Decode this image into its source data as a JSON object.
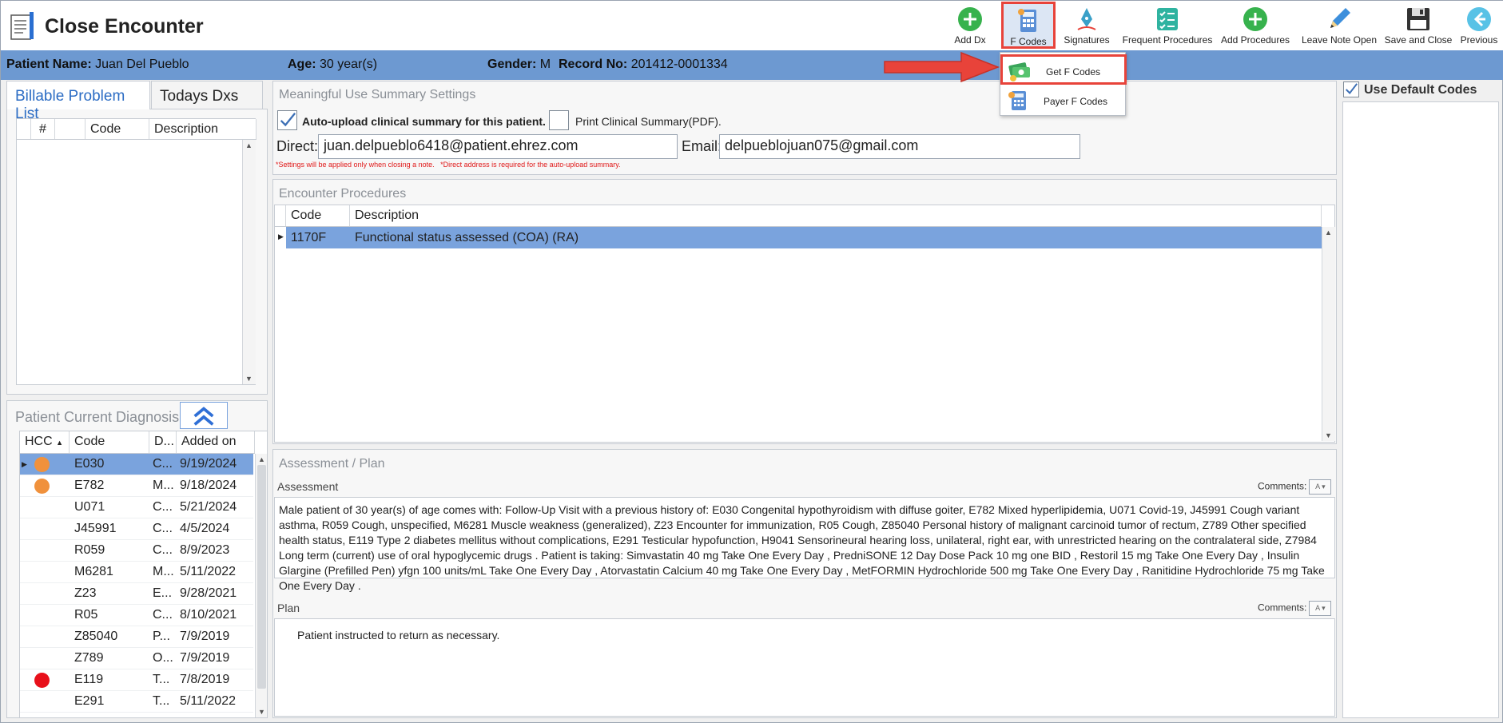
{
  "window": {
    "title": "Close Encounter"
  },
  "toolbar": {
    "add_dx": "Add Dx",
    "f_codes": "F Codes",
    "signatures": "Signatures",
    "frequent_procedures": "Frequent Procedures",
    "add_procedures": "Add Procedures",
    "leave_note_open": "Leave Note Open",
    "save_and_close": "Save and Close",
    "previous": "Previous"
  },
  "fcodes_menu": {
    "get_f_codes": "Get F Codes",
    "payer_f_codes": "Payer F Codes"
  },
  "patient": {
    "name_label": "Patient Name:",
    "name": "Juan Del Pueblo",
    "age_label": "Age:",
    "age": "30 year(s)",
    "gender_label": "Gender:",
    "gender": "M",
    "record_label": "Record No:",
    "record": "201412-0001334"
  },
  "left_tabs": {
    "billable": "Billable Problem List",
    "todays": "Todays Dxs"
  },
  "billable_grid": {
    "col_num": "#",
    "col_code": "Code",
    "col_desc": "Description"
  },
  "current_dx": {
    "title": "Patient Current Diagnosis",
    "headers": {
      "hcc": "HCC",
      "code": "Code",
      "desc": "D...",
      "added": "Added on"
    },
    "rows": [
      {
        "hcc": "orange",
        "code": "E030",
        "desc": "C...",
        "added": "9/19/2024"
      },
      {
        "hcc": "orange",
        "code": "E782",
        "desc": "M...",
        "added": "9/18/2024"
      },
      {
        "hcc": "",
        "code": "U071",
        "desc": "C...",
        "added": "5/21/2024"
      },
      {
        "hcc": "",
        "code": "J45991",
        "desc": "C...",
        "added": "4/5/2024"
      },
      {
        "hcc": "",
        "code": "R059",
        "desc": "C...",
        "added": "8/9/2023"
      },
      {
        "hcc": "",
        "code": "M6281",
        "desc": "M...",
        "added": "5/11/2022"
      },
      {
        "hcc": "",
        "code": "Z23",
        "desc": "E...",
        "added": "9/28/2021"
      },
      {
        "hcc": "",
        "code": "R05",
        "desc": "C...",
        "added": "8/10/2021"
      },
      {
        "hcc": "",
        "code": "Z85040",
        "desc": "P...",
        "added": "7/9/2019"
      },
      {
        "hcc": "",
        "code": "Z789",
        "desc": "O...",
        "added": "7/9/2019"
      },
      {
        "hcc": "red",
        "code": "E119",
        "desc": "T...",
        "added": "7/8/2019"
      },
      {
        "hcc": "",
        "code": "E291",
        "desc": "T...",
        "added": "5/11/2022"
      }
    ]
  },
  "mu": {
    "title": "Meaningful Use Summary Settings",
    "auto_upload": "Auto-upload clinical summary for this patient.",
    "print_summary": "Print Clinical Summary(PDF).",
    "direct_label": "Direct:",
    "direct_value": "juan.delpueblo6418@patient.ehrez.com",
    "email_label": "Email:",
    "email_value": "delpueblojuan075@gmail.com",
    "note": "*Settings will be applied only when closing a note.   *Direct address is required for the auto-upload summary."
  },
  "procedures": {
    "title": "Encounter Procedures",
    "col_code": "Code",
    "col_desc": "Description",
    "rows": [
      {
        "code": "1170F",
        "desc": "Functional status assessed (COA) (RA)"
      }
    ]
  },
  "ap": {
    "title": "Assessment / Plan",
    "assessment_label": "Assessment",
    "comments_label": "Comments:",
    "assessment_text": "Male patient of 30 year(s) of age comes with: Follow-Up Visit  with a previous history of: E030 Congenital hypothyroidism with diffuse goiter, E782 Mixed hyperlipidemia, U071 Covid-19, J45991 Cough variant asthma, R059 Cough, unspecified, M6281 Muscle weakness (generalized), Z23 Encounter for immunization, R05 Cough, Z85040 Personal history of malignant carcinoid tumor of rectum, Z789 Other specified health status, E119 Type 2 diabetes mellitus without complications, E291 Testicular hypofunction, H9041 Sensorineural hearing loss, unilateral, right ear, with unrestricted hearing on the contralateral side, Z7984 Long term (current) use of oral hypoglycemic drugs .  Patient is taking: Simvastatin 40 mg Take One Every Day , PredniSONE 12 Day Dose Pack 10 mg one BID , Restoril 15 mg Take One Every Day , Insulin Glargine (Prefilled Pen) yfgn 100 units/mL Take One Every Day , Atorvastatin Calcium 40 mg Take One Every Day , MetFORMIN Hydrochloride 500 mg Take One Every Day , Ranitidine Hydrochloride 75 mg Take One Every Day  .",
    "plan_label": "Plan",
    "plan_text": "Patient instructed to return as necessary."
  },
  "right_panel": {
    "use_default_codes": "Use Default Codes"
  },
  "colors": {
    "accent": "#6d99d1",
    "selected_row": "#7aa3dd",
    "highlight": "#e8433a",
    "hcc_orange": "#f0913c",
    "hcc_red": "#e8101a"
  }
}
